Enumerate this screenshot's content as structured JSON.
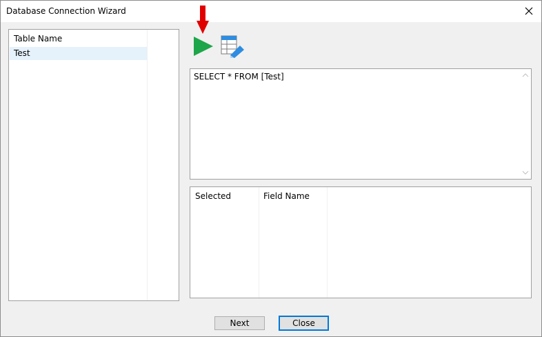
{
  "window": {
    "title": "Database Connection Wizard"
  },
  "icons": {
    "close": "close-icon",
    "run": "run-query-icon",
    "design": "table-design-icon",
    "arrow": "red-arrow-down-icon"
  },
  "tables": {
    "header": "Table Name",
    "items": [
      "Test"
    ],
    "selected_index": 0
  },
  "query": {
    "text": "SELECT * FROM [Test]"
  },
  "fields": {
    "columns": [
      "Selected",
      "Field Name"
    ]
  },
  "buttons": {
    "next": "Next",
    "close": "Close"
  },
  "colors": {
    "selection": "#e5f1fb",
    "run_green": "#1ea64a",
    "arrow_red": "#e00000",
    "focus_blue": "#0078d7"
  }
}
